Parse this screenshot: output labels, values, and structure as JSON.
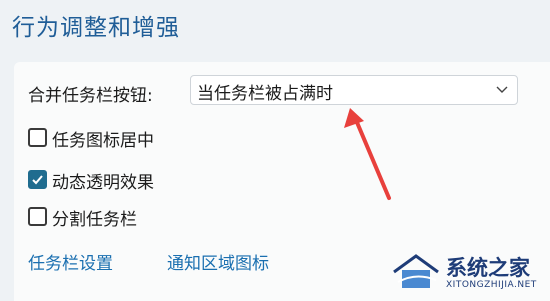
{
  "section": {
    "title": "行为调整和增强"
  },
  "combine_buttons": {
    "label": "合并任务栏按钮:",
    "selected_value": "当任务栏被占满时"
  },
  "checkboxes": [
    {
      "label": "任务图标居中",
      "checked": false
    },
    {
      "label": "动态透明效果",
      "checked": true
    },
    {
      "label": "分割任务栏",
      "checked": false
    }
  ],
  "links": {
    "taskbar_settings": "任务栏设置",
    "tray_icons": "通知区域图标"
  },
  "annotation": {
    "arrow_color": "#e8403c"
  },
  "watermark": {
    "name": "系统之家",
    "domain": "XITONGZHIJIA.NET"
  }
}
